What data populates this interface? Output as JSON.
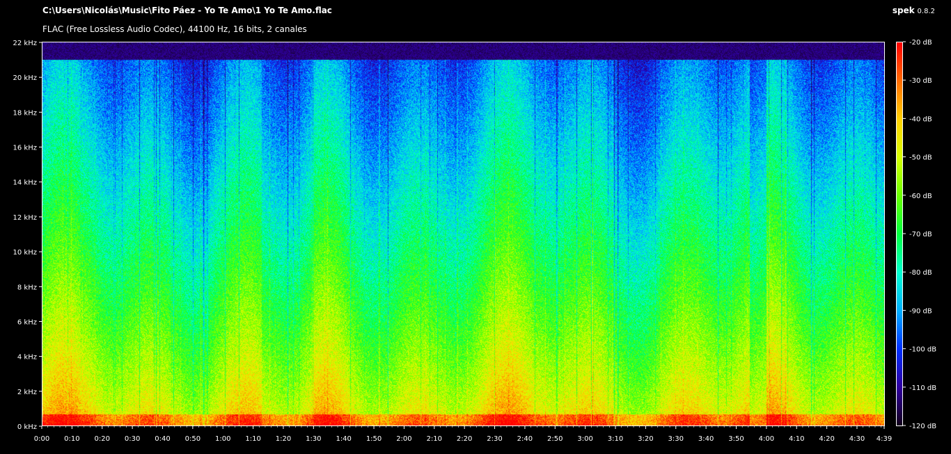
{
  "header": {
    "file_path": "C:\\Users\\Nicolás\\Music\\Fito Páez - Yo Te Amo\\1 Yo Te Amo.flac",
    "file_info": "FLAC (Free Lossless Audio Codec), 44100 Hz, 16 bits, 2 canales",
    "app_name": "spek",
    "app_version": "0.8.2"
  },
  "spectrogram": {
    "freq_axis": {
      "ticks": [
        "0 kHz",
        "2 kHz",
        "4 kHz",
        "6 kHz",
        "8 kHz",
        "10 kHz",
        "12 kHz",
        "14 kHz",
        "16 kHz",
        "18 kHz",
        "20 kHz",
        "22 kHz"
      ],
      "range_khz": [
        0,
        22
      ]
    },
    "time_axis": {
      "ticks": [
        "0:00",
        "0:10",
        "0:20",
        "0:30",
        "0:40",
        "0:50",
        "1:00",
        "1:10",
        "1:20",
        "1:30",
        "1:40",
        "1:50",
        "2:00",
        "2:10",
        "2:20",
        "2:30",
        "2:40",
        "2:50",
        "3:00",
        "3:10",
        "3:20",
        "3:30",
        "3:40",
        "3:50",
        "4:00",
        "4:10",
        "4:20",
        "4:30",
        "4:39"
      ],
      "duration_seconds": 279
    },
    "db_scale": {
      "ticks": [
        "-20 dB",
        "-30 dB",
        "-40 dB",
        "-50 dB",
        "-60 dB",
        "-70 dB",
        "-80 dB",
        "-90 dB",
        "-100 dB",
        "-110 dB",
        "-120 dB"
      ],
      "range_db": [
        -120,
        -20
      ],
      "colors": [
        "#ff0000",
        "#ff6a00",
        "#ffd000",
        "#d8ff00",
        "#6aff00",
        "#00ff40",
        "#00ffd0",
        "#00b0ff",
        "#0030ff",
        "#3000a0",
        "#12001a"
      ]
    }
  }
}
